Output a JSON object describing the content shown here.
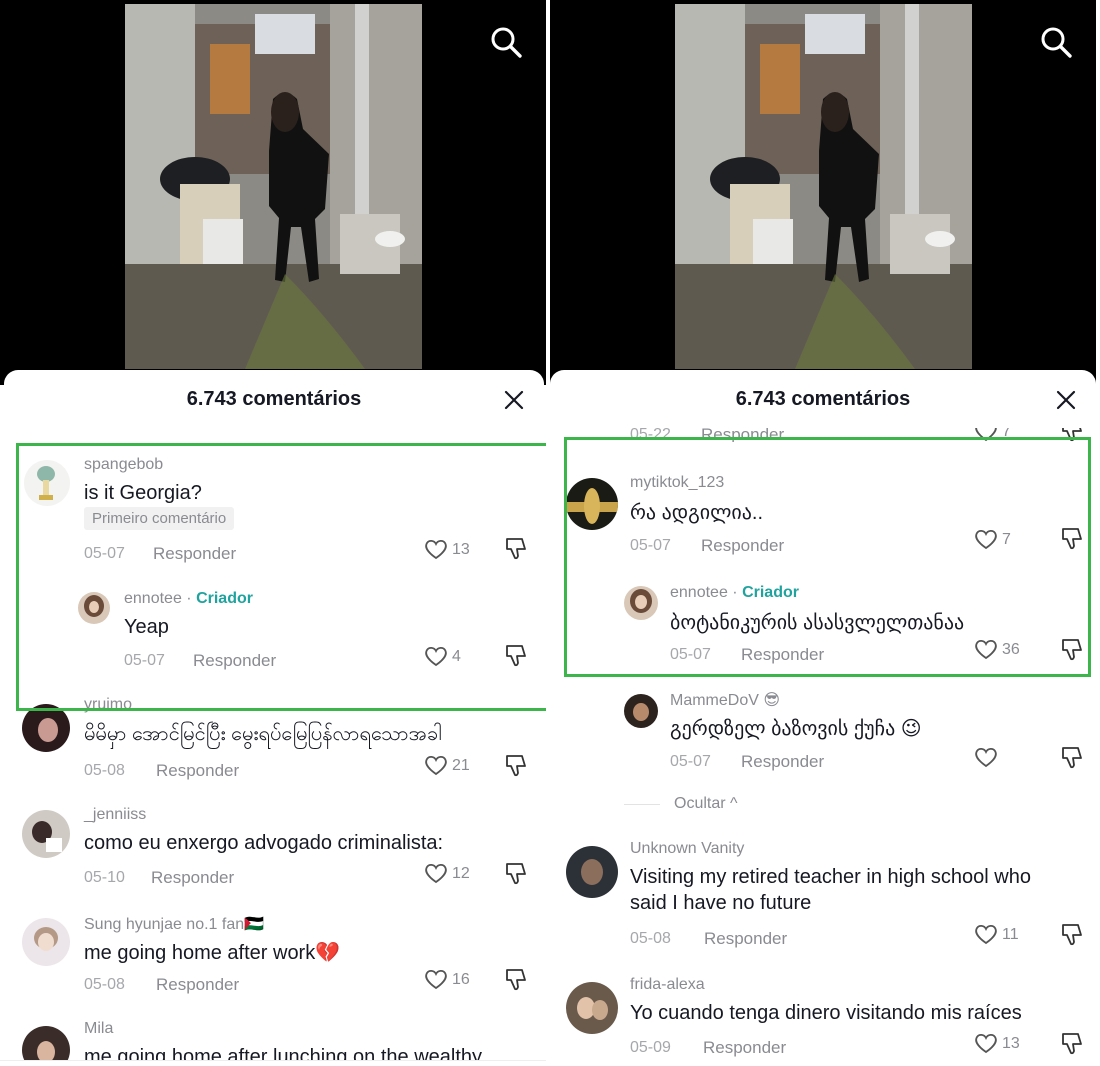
{
  "header_title": "6.743 comentários",
  "reply_label": "Responder",
  "left": {
    "comments": [
      {
        "user": "spangebob",
        "text": "is it Georgia?",
        "badge": "Primeiro comentário",
        "date": "05-07",
        "likes": "13"
      },
      {
        "user": "ennotee",
        "creator_label": "Criador",
        "text": "Yeap",
        "date": "05-07",
        "likes": "4"
      },
      {
        "user": "yruimo",
        "text": "မိမိမှာ အောင်မြင်ပြီး မွေးရပ်မြေပြန်လာရသောအခါ",
        "date": "05-08",
        "likes": "21"
      },
      {
        "user": "_jenniiss",
        "text": "como eu enxergo advogado criminalista:",
        "date": "05-10",
        "likes": "12"
      },
      {
        "user": "Sung hyunjae no.1 fan🇵🇸",
        "text": "me going home after work💔",
        "date": "05-08",
        "likes": "16"
      },
      {
        "user": "Mila",
        "text": "me going home after lunching on the wealthy"
      }
    ]
  },
  "right": {
    "partial_top": {
      "date": "05-22",
      "likes": "7"
    },
    "comments": [
      {
        "user": "mytiktok_123",
        "text": "რა ადგილია..",
        "date": "05-07",
        "likes": "7"
      },
      {
        "user": "ennotee",
        "creator_label": "Criador",
        "text": "ბოტანიკურის ასასვლელთანაა",
        "date": "05-07",
        "likes": "36"
      },
      {
        "user": "MammeDoV 😎",
        "text": "გერდზელ ბაზოვის ქუჩა 😉",
        "date": "05-07",
        "likes": ""
      },
      {
        "user": "Unknown Vanity",
        "text_line1": "Visiting my retired teacher in high school who",
        "text_line2": "said I have no future",
        "date": "05-08",
        "likes": "11"
      },
      {
        "user": "frida-alexa",
        "text": "Yo cuando tenga dinero visitando mis raíces",
        "date": "05-09",
        "likes": "13"
      }
    ],
    "hide_label": "Ocultar ^"
  },
  "colors": {
    "highlight": "#3cb54a",
    "creator": "#20a39e",
    "muted": "#8a8b91"
  }
}
